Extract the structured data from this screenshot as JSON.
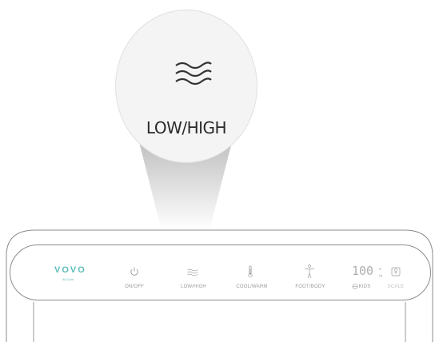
{
  "zoom": {
    "label": "LOW/HIGH",
    "icon": "waves-icon"
  },
  "brand": {
    "name": "VOVO",
    "sub": "All Care"
  },
  "panel": {
    "buttons": [
      {
        "id": "on-off",
        "label": "ON/OFF",
        "icon": "power-icon"
      },
      {
        "id": "low-high",
        "label": "LOW/HIGH",
        "icon": "waves-icon"
      },
      {
        "id": "cool-warm",
        "label": "COOL/WARM",
        "icon": "thermometer-icon"
      },
      {
        "id": "foot-body",
        "label": "FOOT/BODY",
        "icon": "person-icon"
      },
      {
        "id": "kids",
        "label": "KIDS",
        "icon": "kids-icon"
      },
      {
        "id": "scale",
        "label": "SCALE",
        "icon": "scale-icon"
      }
    ],
    "display": {
      "digits": "100",
      "unit_lb": "lb",
      "unit_kg": "kg"
    }
  },
  "colors": {
    "brand": "#5bbcb8",
    "outline": "#8c8c8c",
    "label": "#9a9a9a"
  }
}
